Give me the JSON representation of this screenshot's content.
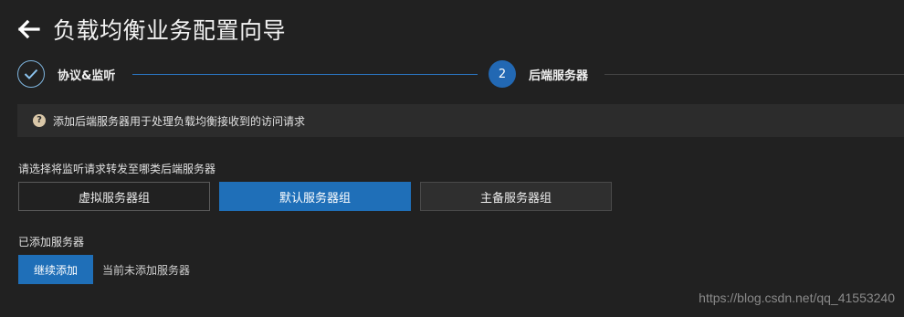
{
  "header": {
    "back_icon": "arrow-left-icon",
    "title": "负载均衡业务配置向导"
  },
  "stepper": {
    "steps": [
      {
        "label": "协议&监听",
        "status": "done",
        "icon": "check-icon"
      },
      {
        "label": "后端服务器",
        "status": "active",
        "number": "2"
      }
    ]
  },
  "notice": {
    "icon": "help-icon",
    "icon_glyph": "?",
    "text": "添加后端服务器用于处理负载均衡接收到的访问请求"
  },
  "server_group": {
    "label": "请选择将监听请求转发至哪类后端服务器",
    "options": [
      "虚拟服务器组",
      "默认服务器组",
      "主备服务器组"
    ],
    "selected": "默认服务器组"
  },
  "added_servers": {
    "label": "已添加服务器",
    "continue_button": "继续添加",
    "empty_text": "当前未添加服务器"
  },
  "watermark": "https://blog.csdn.net/qq_41553240",
  "colors": {
    "background": "#212121",
    "accent": "#1f6fb8",
    "notice_bg": "#2c2c2c"
  }
}
